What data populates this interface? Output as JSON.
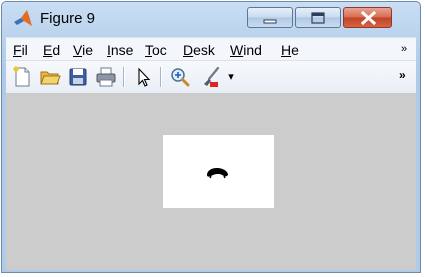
{
  "window": {
    "title": "Figure 9"
  },
  "menu": {
    "items": [
      {
        "key": "file",
        "label": "Fil",
        "underline": "F",
        "rest": "il"
      },
      {
        "key": "edit",
        "label": "Ed",
        "underline": "E",
        "rest": "d"
      },
      {
        "key": "view",
        "label": "Vie",
        "underline": "V",
        "rest": "ie"
      },
      {
        "key": "insert",
        "label": "Inse",
        "underline": "I",
        "rest": "nse"
      },
      {
        "key": "tools",
        "label": "Toc",
        "underline": "T",
        "rest": "oc"
      },
      {
        "key": "desktop",
        "label": "Desk",
        "underline": "D",
        "rest": "esk"
      },
      {
        "key": "window",
        "label": "Wind",
        "underline": "W",
        "rest": "ind"
      },
      {
        "key": "help",
        "label": "He",
        "underline": "H",
        "rest": "e"
      }
    ],
    "overflow_glyph": "»"
  },
  "toolbar": {
    "icons": [
      "new-file-icon",
      "open-folder-icon",
      "save-icon",
      "print-icon",
      "pointer-icon",
      "zoom-in-icon",
      "brush-icon",
      "dropdown-arrow-icon"
    ],
    "dropdown_glyph": "▾",
    "overflow_glyph": "»"
  },
  "colors": {
    "figure_background": "#cccccc",
    "axes_background": "#ffffff",
    "close_button": "#c8482c",
    "title_gradient": "#b9d1ec"
  }
}
